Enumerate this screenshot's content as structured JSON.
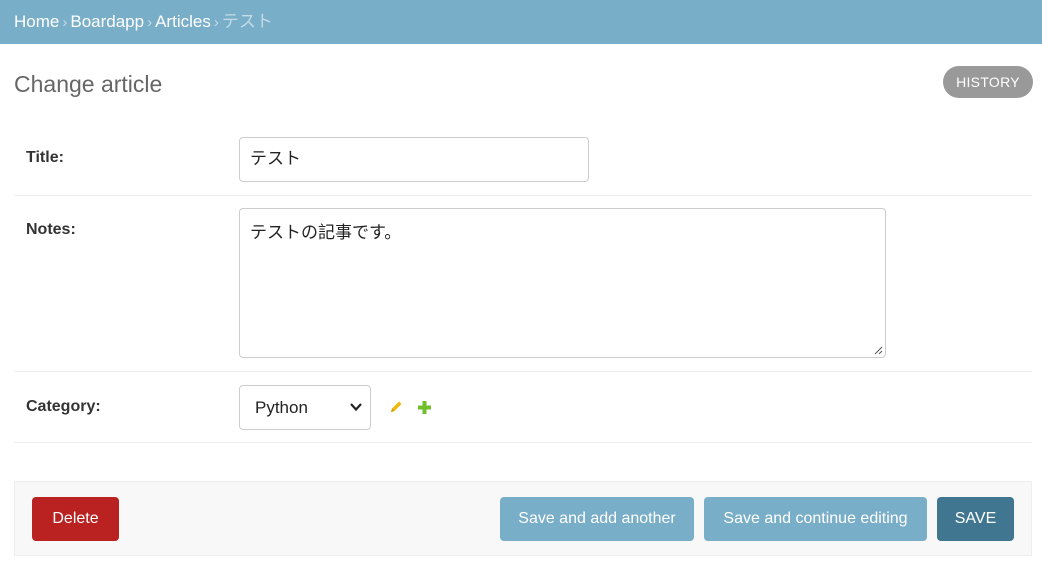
{
  "breadcrumbs": {
    "home": "Home",
    "app": "Boardapp",
    "model": "Articles",
    "current": "テスト",
    "separator": "›"
  },
  "page": {
    "title": "Change article",
    "history_label": "HISTORY"
  },
  "form": {
    "title": {
      "label": "Title:",
      "value": "テスト"
    },
    "notes": {
      "label": "Notes:",
      "value": "テストの記事です。"
    },
    "category": {
      "label": "Category:",
      "selected": "Python"
    }
  },
  "actions": {
    "delete_label": "Delete",
    "save_add_another_label": "Save and add another",
    "save_continue_label": "Save and continue editing",
    "save_label": "SAVE"
  },
  "colors": {
    "header": "#79aec8",
    "delete": "#ba2121",
    "secondary_button": "#79aec8",
    "primary_button": "#417690",
    "history": "#999999",
    "edit_icon": "#efb80b",
    "add_icon": "#70bf2b"
  },
  "icons": {
    "edit": "pencil-icon",
    "add": "plus-icon",
    "select": "chevron-down-icon",
    "resize": "resize-handle-icon"
  }
}
